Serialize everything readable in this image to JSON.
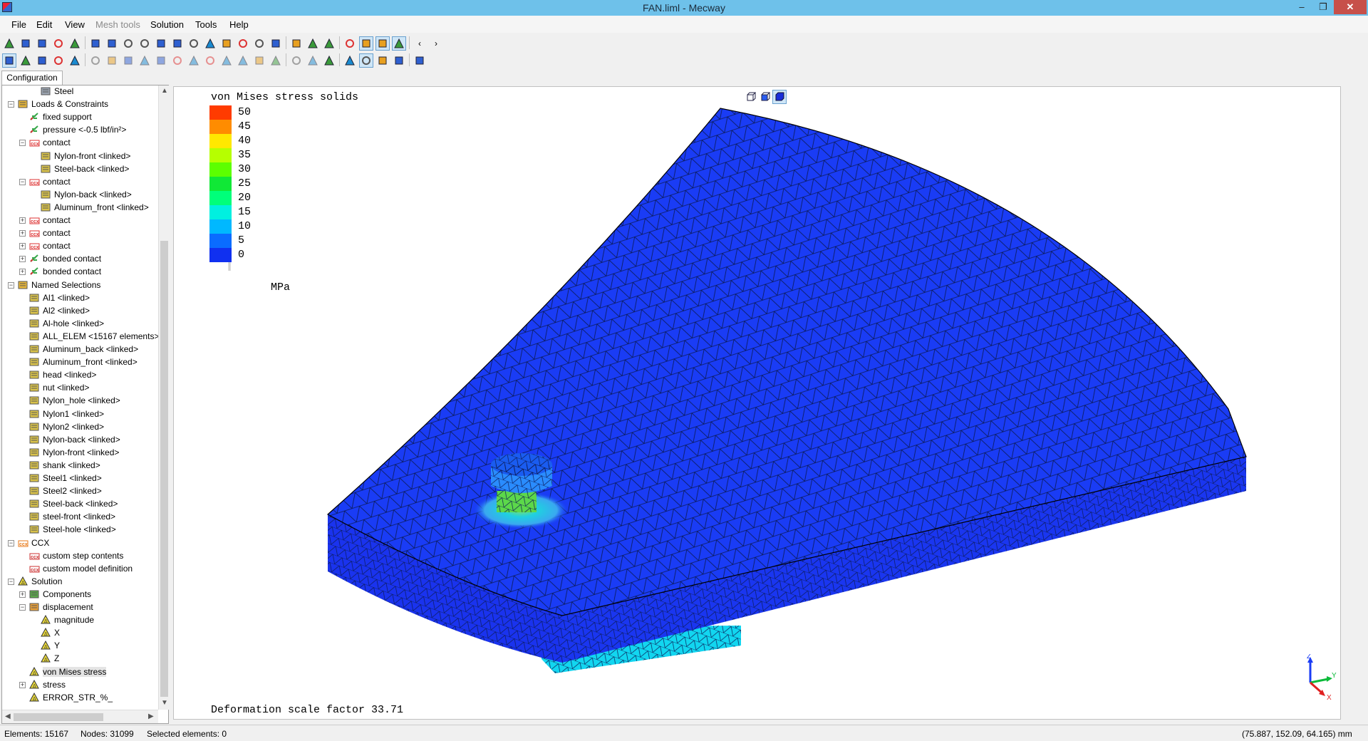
{
  "window": {
    "title": "FAN.liml - Mecway",
    "minimize": "–",
    "restore": "❐",
    "close": "✕"
  },
  "menu": [
    "File",
    "Edit",
    "View",
    "Mesh tools",
    "Solution",
    "Tools",
    "Help"
  ],
  "toolbar1_icons": [
    "new-file-icon",
    "open-folder-icon",
    "save-icon",
    "undo-icon",
    "redo-icon",
    "layers-icon",
    "view-iso-icon",
    "view-front-icon",
    "view-back-icon",
    "view-left-icon",
    "view-right-icon",
    "view-top-icon",
    "view-bottom-icon",
    "zoom-fit-icon",
    "zoom-icon",
    "rotate-icon",
    "pan-icon",
    "print-icon",
    "clipboard-icon",
    "copy-image-icon",
    "surface-icon",
    "shaded-icon",
    "wireframe-icon",
    "mesh-icon",
    "scroll-left-icon",
    "scroll-right-icon"
  ],
  "toolbar2_icons": [
    "select-icon",
    "node-select-icon",
    "link-icon",
    "face-select-icon",
    "nodes-icon",
    "element-icon",
    "hide-icon",
    "delete-icon",
    "explode-icon",
    "split-icon",
    "merge-icon",
    "mirror-icon",
    "copy-mesh-icon",
    "cylinder-icon",
    "sweep-icon",
    "revolve-icon",
    "refine-icon",
    "smooth-icon",
    "triangle-outline-icon",
    "triangle-icon",
    "contour-icon",
    "deformed-icon",
    "cube-color-icon",
    "colormap-icon",
    "table-icon"
  ],
  "tab": "Configuration",
  "tree": [
    {
      "label": "Steel",
      "level": 3,
      "icon": "material-icon"
    },
    {
      "label": "Loads & Constraints",
      "level": 1,
      "icon": "folder-icon",
      "toggle": "-"
    },
    {
      "label": "fixed support",
      "level": 2,
      "icon": "constraint-icon"
    },
    {
      "label": "pressure <-0.5 lbf/in²>",
      "level": 2,
      "icon": "constraint-icon"
    },
    {
      "label": "contact",
      "level": 2,
      "icon": "ccx-contact-icon",
      "toggle": "-"
    },
    {
      "label": "Nylon-front <linked>",
      "level": 3,
      "icon": "selection-icon"
    },
    {
      "label": "Steel-back <linked>",
      "level": 3,
      "icon": "selection-icon"
    },
    {
      "label": "contact",
      "level": 2,
      "icon": "ccx-contact-icon",
      "toggle": "-"
    },
    {
      "label": "Nylon-back <linked>",
      "level": 3,
      "icon": "selection-icon"
    },
    {
      "label": "Aluminum_front <linked>",
      "level": 3,
      "icon": "selection-icon"
    },
    {
      "label": "contact",
      "level": 2,
      "icon": "ccx-contact-icon",
      "toggle": "+"
    },
    {
      "label": "contact",
      "level": 2,
      "icon": "ccx-contact-icon",
      "toggle": "+"
    },
    {
      "label": "contact",
      "level": 2,
      "icon": "ccx-contact-icon",
      "toggle": "+"
    },
    {
      "label": "bonded contact",
      "level": 2,
      "icon": "constraint-icon",
      "toggle": "+"
    },
    {
      "label": "bonded contact",
      "level": 2,
      "icon": "constraint-icon",
      "toggle": "+"
    },
    {
      "label": "Named Selections",
      "level": 1,
      "icon": "folder-icon",
      "toggle": "-"
    },
    {
      "label": "Al1 <linked>",
      "level": 2,
      "icon": "selection-icon"
    },
    {
      "label": "Al2 <linked>",
      "level": 2,
      "icon": "selection-icon"
    },
    {
      "label": "Al-hole <linked>",
      "level": 2,
      "icon": "selection-icon"
    },
    {
      "label": "ALL_ELEM <15167 elements>",
      "level": 2,
      "icon": "selection-icon"
    },
    {
      "label": "Aluminum_back <linked>",
      "level": 2,
      "icon": "selection-icon"
    },
    {
      "label": "Aluminum_front <linked>",
      "level": 2,
      "icon": "selection-icon"
    },
    {
      "label": "head <linked>",
      "level": 2,
      "icon": "selection-icon"
    },
    {
      "label": "nut <linked>",
      "level": 2,
      "icon": "selection-icon"
    },
    {
      "label": "Nylon_hole <linked>",
      "level": 2,
      "icon": "selection-icon"
    },
    {
      "label": "Nylon1 <linked>",
      "level": 2,
      "icon": "selection-icon"
    },
    {
      "label": "Nylon2 <linked>",
      "level": 2,
      "icon": "selection-icon"
    },
    {
      "label": "Nylon-back <linked>",
      "level": 2,
      "icon": "selection-icon"
    },
    {
      "label": "Nylon-front <linked>",
      "level": 2,
      "icon": "selection-icon"
    },
    {
      "label": "shank <linked>",
      "level": 2,
      "icon": "selection-icon"
    },
    {
      "label": "Steel1 <linked>",
      "level": 2,
      "icon": "selection-icon"
    },
    {
      "label": "Steel2 <linked>",
      "level": 2,
      "icon": "selection-icon"
    },
    {
      "label": "Steel-back <linked>",
      "level": 2,
      "icon": "selection-icon"
    },
    {
      "label": "steel-front <linked>",
      "level": 2,
      "icon": "selection-icon"
    },
    {
      "label": "Steel-hole <linked>",
      "level": 2,
      "icon": "selection-icon"
    },
    {
      "label": "CCX",
      "level": 1,
      "icon": "ccx-icon",
      "toggle": "-"
    },
    {
      "label": "custom step contents",
      "level": 2,
      "icon": "ccx-file-icon"
    },
    {
      "label": "custom model definition",
      "level": 2,
      "icon": "ccx-file-icon"
    },
    {
      "label": "Solution",
      "level": 1,
      "icon": "solution-icon",
      "toggle": "-"
    },
    {
      "label": "Components",
      "level": 2,
      "icon": "components-icon",
      "toggle": "+"
    },
    {
      "label": "displacement",
      "level": 2,
      "icon": "displacement-icon",
      "toggle": "-"
    },
    {
      "label": "magnitude",
      "level": 3,
      "icon": "result-icon"
    },
    {
      "label": "X",
      "level": 3,
      "icon": "result-icon"
    },
    {
      "label": "Y",
      "level": 3,
      "icon": "result-icon"
    },
    {
      "label": "Z",
      "level": 3,
      "icon": "result-icon"
    },
    {
      "label": "von Mises stress",
      "level": 2,
      "icon": "result-icon",
      "selected": true
    },
    {
      "label": "stress",
      "level": 2,
      "icon": "result-icon",
      "toggle": "+"
    },
    {
      "label": "ERROR_STR_%_",
      "level": 2,
      "icon": "result-icon"
    }
  ],
  "viewport": {
    "title": "von Mises stress solids",
    "legend_values": [
      "50",
      "45",
      "40",
      "35",
      "30",
      "25",
      "20",
      "15",
      "10",
      "5",
      "0"
    ],
    "legend_colors": [
      "#ff3b00",
      "#ff8c00",
      "#ffe800",
      "#b6ff00",
      "#5cff00",
      "#10e836",
      "#00ff7a",
      "#00f0e0",
      "#00b8ff",
      "#0a6cff",
      "#1030f0"
    ],
    "unit": "MPa",
    "scale_text": "Deformation scale factor 33.71",
    "axes": {
      "z": "Z",
      "y": "Y",
      "x": "X"
    }
  },
  "status": {
    "elements": "Elements: 15167",
    "nodes": "Nodes: 31099",
    "selected": "Selected elements: 0",
    "coords": "(75.887, 152.09, 64.165) mm"
  }
}
